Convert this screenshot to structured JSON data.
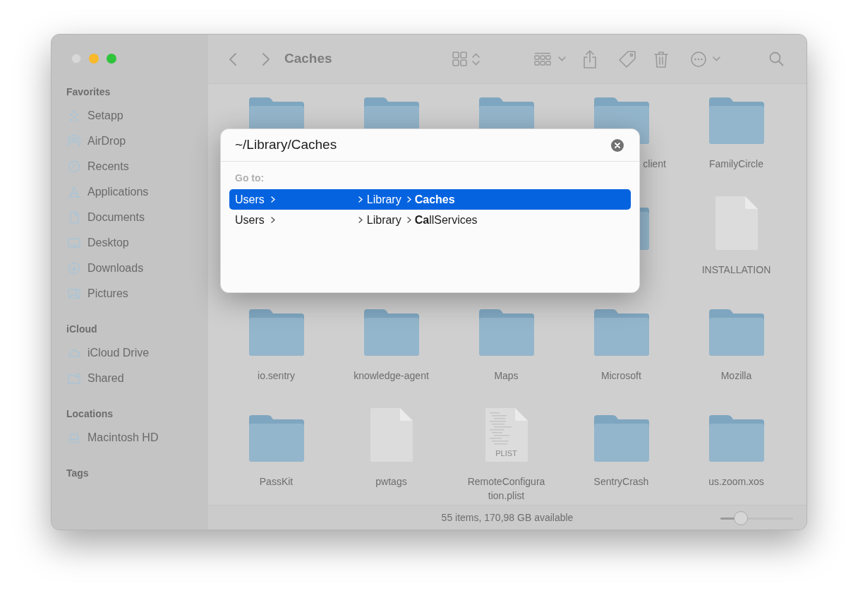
{
  "window": {
    "title": "Caches"
  },
  "sidebar": {
    "sections": [
      {
        "heading": "Favorites",
        "items": [
          "Setapp",
          "AirDrop",
          "Recents",
          "Applications",
          "Documents",
          "Desktop",
          "Downloads",
          "Pictures"
        ]
      },
      {
        "heading": "iCloud",
        "items": [
          "iCloud Drive",
          "Shared"
        ]
      },
      {
        "heading": "Locations",
        "items": [
          "Macintosh HD"
        ]
      },
      {
        "heading": "Tags"
      }
    ]
  },
  "files": [
    {
      "items": [
        {
          "kind": "folder"
        },
        {
          "kind": "folder"
        },
        {
          "kind": "folder"
        },
        {
          "kind": "folder",
          "label": "client",
          "label_cut": true
        },
        {
          "kind": "folder",
          "label": "FamilyCircle"
        }
      ]
    },
    {
      "items": [
        {
          "kind": "folder"
        },
        {
          "kind": "document",
          "label": "INSTALLATION"
        }
      ]
    },
    {
      "items": [
        {
          "kind": "folder",
          "label": "io.sentry"
        },
        {
          "kind": "folder",
          "label": "knowledge-agent"
        },
        {
          "kind": "folder",
          "label": "Maps"
        },
        {
          "kind": "folder",
          "label": "Microsoft"
        },
        {
          "kind": "folder",
          "label": "Mozilla"
        }
      ]
    },
    {
      "items": [
        {
          "kind": "folder",
          "label": "PassKit"
        },
        {
          "kind": "document",
          "label": "pwtags"
        },
        {
          "kind": "plist",
          "label": "RemoteConfiguration.plist",
          "badge": "PLIST"
        },
        {
          "kind": "folder",
          "label": "SentryCrash"
        },
        {
          "kind": "folder",
          "label": "us.zoom.xos"
        }
      ]
    }
  ],
  "status_bar": {
    "text": "55 items, 170,98 GB available",
    "zoom_slider": {
      "level": 0.26
    }
  },
  "go_to_dialog": {
    "value": "~/Library/Caches",
    "heading": "Go to:",
    "results": [
      {
        "start": "Users",
        "parent": "Library",
        "match": "Caches",
        "selected": true
      },
      {
        "start": "Users",
        "parent": "Library",
        "match": "Ca",
        "rest": "llServices",
        "selected": false
      }
    ]
  }
}
